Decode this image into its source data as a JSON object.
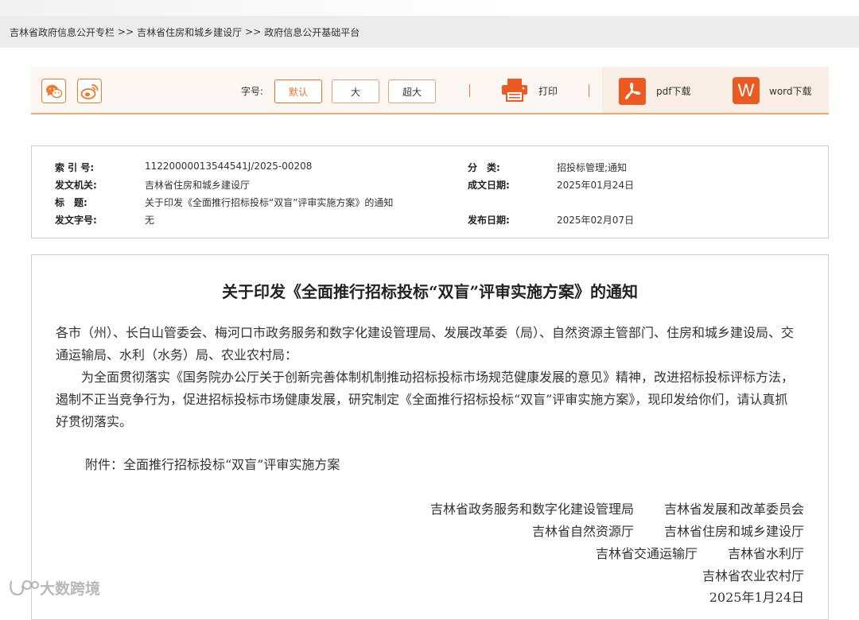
{
  "breadcrumb": {
    "items": [
      "吉林省政府信息公开专栏",
      "吉林省住房和城乡建设厅",
      "政府信息公开基础平台"
    ],
    "separator": ">>"
  },
  "toolbar": {
    "share_icons": [
      "wechat-icon",
      "weibo-icon"
    ],
    "font_size_label": "字号:",
    "font_sizes": [
      "默认",
      "大",
      "超大"
    ],
    "print_label": "打印",
    "pdf_label": "pdf下载",
    "word_label": "word下载",
    "word_icon_letter": "W",
    "accent_color": "#ea5a22"
  },
  "meta": {
    "index_key": "索 引 号:",
    "index_value": "11220000013544541J/2025-00208",
    "category_key": "分　类:",
    "category_value": "招投标管理;通知",
    "issuer_key": "发文机关:",
    "issuer_value": "吉林省住房和城乡建设厅",
    "date_key": "成文日期:",
    "date_value": "2025年01月24日",
    "title_key": "标　题:",
    "title_value": "关于印发《全面推行招标投标“双盲”评审实施方案》的通知",
    "docno_key": "发文字号:",
    "docno_value": "无",
    "publish_key": "发布日期:",
    "publish_value": "2025年02月07日"
  },
  "document": {
    "title": "关于印发《全面推行招标投标“双盲”评审实施方案》的通知",
    "address": "各市（州）、长白山管委会、梅河口市政务服务和数字化建设管理局、发展改革委（局）、自然资源主管部门、住房和城乡建设局、交通运输局、水利（水务）局、农业农村局：",
    "body": "为全面贯彻落实《国务院办公厅关于创新完善体制机制推动招标投标市场规范健康发展的意见》精神，改进招标投标评标方法，遏制不正当竞争行为，促进招标投标市场健康发展，研究制定《全面推行招标投标“双盲”评审实施方案》，现印发给你们，请认真抓好贯彻落实。",
    "attachment": "附件：全面推行招标投标“双盲”评审实施方案",
    "signatures": [
      [
        "吉林省政务服务和数字化建设管理局",
        "吉林省发展和改革委员会"
      ],
      [
        "吉林省自然资源厅",
        "吉林省住房和城乡建设厅"
      ],
      [
        "吉林省交通运输厅",
        "吉林省水利厅"
      ],
      [
        "吉林省农业农村厅"
      ]
    ],
    "date": "2025年1月24日"
  },
  "watermark": {
    "text": "大数跨境"
  }
}
